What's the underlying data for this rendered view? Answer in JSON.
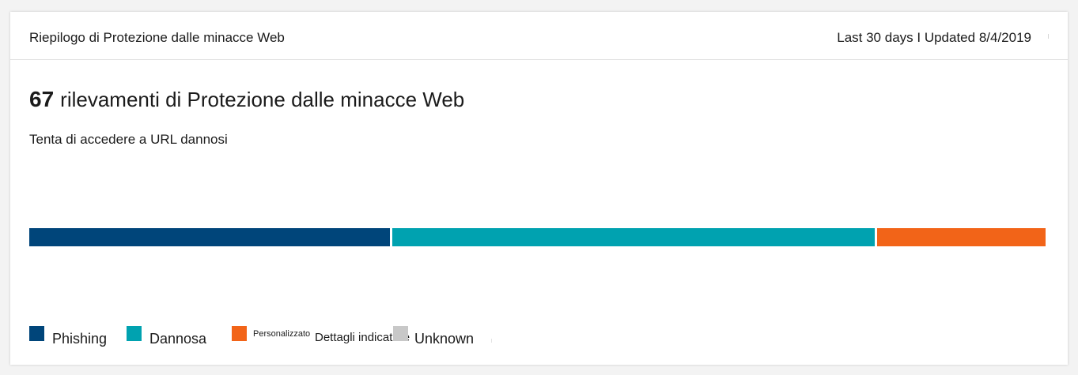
{
  "card": {
    "title": "Riepilogo di Protezione dalle minacce Web",
    "meta": "Last 30 days I Updated 8/4/2019"
  },
  "summary": {
    "count": "67",
    "headline": "rilevamenti di Protezione dalle minacce Web",
    "subtitle": "Tenta di accedere a URL dannosi"
  },
  "colors": {
    "phishing": "#00457a",
    "dannosa": "#00a2b0",
    "custom": "#f26418",
    "unknown": "#c8c8c8"
  },
  "chart_data": {
    "type": "bar",
    "orientation": "horizontal-stacked",
    "categories": [
      "Phishing",
      "Dannosa",
      "Personalizzato",
      "Unknown"
    ],
    "fractions": [
      0.357,
      0.477,
      0.166,
      0.0
    ]
  },
  "legend": {
    "phishing": "Phishing",
    "dannosa": "Dannosa",
    "custom": "Personalizzato",
    "custom_detail": "Dettagli indicatore",
    "unknown": "Unknown"
  }
}
